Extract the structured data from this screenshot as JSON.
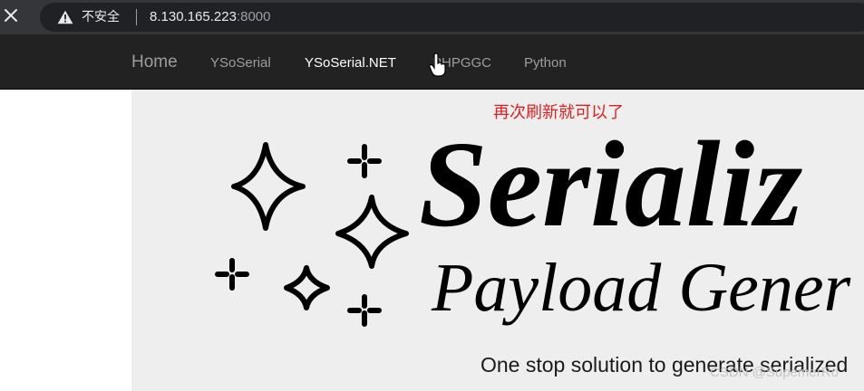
{
  "browser": {
    "security_label": "不安全",
    "url_host": "8.130.165.223",
    "url_port": ":8000"
  },
  "navbar": {
    "brand": "Home",
    "links": [
      {
        "label": "YSoSerial",
        "active": false
      },
      {
        "label": "YSoSerial.NET",
        "active": true
      },
      {
        "label": "PHPGGC",
        "active": false
      },
      {
        "label": "Python",
        "active": false
      }
    ]
  },
  "annotation": "再次刷新就可以了",
  "hero": {
    "title": "Serializ",
    "subtitle": "Payload Gener",
    "tagline": "One stop solution to generate serialized"
  },
  "watermark": "CSDN @SupemerRo",
  "colors": {
    "nav_bg": "#222222",
    "nav_link": "#9d9d9d",
    "nav_active": "#ffffff",
    "annotation": "#e02020",
    "content_bg": "#eeeeee"
  },
  "icons": [
    "close-icon",
    "warning-icon",
    "sparkles-icon",
    "hand-pointer-icon"
  ]
}
